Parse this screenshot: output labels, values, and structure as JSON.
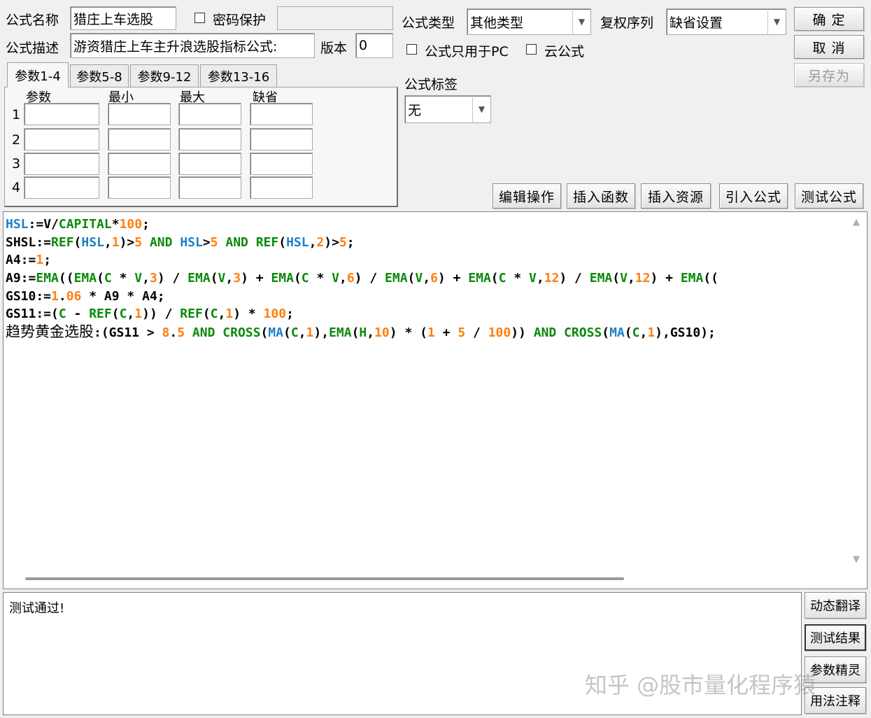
{
  "top": {
    "name_label": "公式名称",
    "name_value": "猎庄上车选股",
    "password_label": "密码保护",
    "type_label": "公式类型",
    "type_value": "其他类型",
    "rights_label": "复权序列",
    "rights_value": "缺省设置",
    "desc_label": "公式描述",
    "desc_value": "游资猎庄上车主升浪选股指标公式:",
    "version_label": "版本",
    "version_value": "0",
    "pc_only_label": "公式只用于PC",
    "cloud_label": "云公式",
    "tag_label": "公式标签",
    "tag_value": "无"
  },
  "buttons": {
    "ok": "确 定",
    "cancel": "取 消",
    "save_as": "另存为",
    "edit": "编辑操作",
    "insert_func": "插入函数",
    "insert_res": "插入资源",
    "import": "引入公式",
    "test": "测试公式",
    "dyn_translate": "动态翻译",
    "test_result": "测试结果",
    "param_wizard": "参数精灵",
    "usage_notes": "用法注释"
  },
  "tabs": [
    "参数1-4",
    "参数5-8",
    "参数9-12",
    "参数13-16"
  ],
  "params": {
    "headers": [
      "参数",
      "最小",
      "最大",
      "缺省"
    ],
    "rows": [
      "1",
      "2",
      "3",
      "4"
    ]
  },
  "colors": {
    "blue": "#1f7fc7",
    "green": "#0a8a0a",
    "orange": "#ff7f0e",
    "black": "#000000"
  },
  "code_lines": [
    [
      [
        "HSL",
        "blue"
      ],
      [
        ":=V/",
        "black"
      ],
      [
        "CAPITAL",
        "green"
      ],
      [
        "*",
        "black"
      ],
      [
        "100",
        "orange"
      ],
      [
        ";",
        "black"
      ]
    ],
    [
      [
        "SHSL:=",
        "black"
      ],
      [
        "REF",
        "green"
      ],
      [
        "(",
        "black"
      ],
      [
        "HSL",
        "blue"
      ],
      [
        ",",
        "black"
      ],
      [
        "1",
        "orange"
      ],
      [
        ")>",
        "black"
      ],
      [
        "5",
        "orange"
      ],
      [
        " AND ",
        "green"
      ],
      [
        "HSL",
        "blue"
      ],
      [
        ">",
        "black"
      ],
      [
        "5",
        "orange"
      ],
      [
        " AND ",
        "green"
      ],
      [
        "REF",
        "green"
      ],
      [
        "(",
        "black"
      ],
      [
        "HSL",
        "blue"
      ],
      [
        ",",
        "black"
      ],
      [
        "2",
        "orange"
      ],
      [
        ")>",
        "black"
      ],
      [
        "5",
        "orange"
      ],
      [
        ";",
        "black"
      ]
    ],
    [
      [
        "A4:=",
        "black"
      ],
      [
        "1",
        "orange"
      ],
      [
        ";",
        "black"
      ]
    ],
    [
      [
        "A9:=",
        "black"
      ],
      [
        "EMA",
        "green"
      ],
      [
        "((",
        "black"
      ],
      [
        "EMA",
        "green"
      ],
      [
        "(",
        "black"
      ],
      [
        "C",
        "green"
      ],
      [
        " * ",
        "black"
      ],
      [
        "V",
        "green"
      ],
      [
        ",",
        "black"
      ],
      [
        "3",
        "orange"
      ],
      [
        ") / ",
        "black"
      ],
      [
        "EMA",
        "green"
      ],
      [
        "(",
        "black"
      ],
      [
        "V",
        "green"
      ],
      [
        ",",
        "black"
      ],
      [
        "3",
        "orange"
      ],
      [
        ") + ",
        "black"
      ],
      [
        "EMA",
        "green"
      ],
      [
        "(",
        "black"
      ],
      [
        "C",
        "green"
      ],
      [
        " * ",
        "black"
      ],
      [
        "V",
        "green"
      ],
      [
        ",",
        "black"
      ],
      [
        "6",
        "orange"
      ],
      [
        ") / ",
        "black"
      ],
      [
        "EMA",
        "green"
      ],
      [
        "(",
        "black"
      ],
      [
        "V",
        "green"
      ],
      [
        ",",
        "black"
      ],
      [
        "6",
        "orange"
      ],
      [
        ") + ",
        "black"
      ],
      [
        "EMA",
        "green"
      ],
      [
        "(",
        "black"
      ],
      [
        "C",
        "green"
      ],
      [
        " * ",
        "black"
      ],
      [
        "V",
        "green"
      ],
      [
        ",",
        "black"
      ],
      [
        "12",
        "orange"
      ],
      [
        ") / ",
        "black"
      ],
      [
        "EMA",
        "green"
      ],
      [
        "(",
        "black"
      ],
      [
        "V",
        "green"
      ],
      [
        ",",
        "black"
      ],
      [
        "12",
        "orange"
      ],
      [
        ") + ",
        "black"
      ],
      [
        "EMA",
        "green"
      ],
      [
        "((",
        "black"
      ]
    ],
    [
      [
        "GS10:=",
        "black"
      ],
      [
        "1",
        "orange"
      ],
      [
        ".",
        "black"
      ],
      [
        "06",
        "orange"
      ],
      [
        " * A9 * A4;",
        "black"
      ]
    ],
    [
      [
        "GS11:=(",
        "black"
      ],
      [
        "C",
        "green"
      ],
      [
        " - ",
        "black"
      ],
      [
        "REF",
        "green"
      ],
      [
        "(",
        "black"
      ],
      [
        "C",
        "green"
      ],
      [
        ",",
        "black"
      ],
      [
        "1",
        "orange"
      ],
      [
        ")) / ",
        "black"
      ],
      [
        "REF",
        "green"
      ],
      [
        "(",
        "black"
      ],
      [
        "C",
        "green"
      ],
      [
        ",",
        "black"
      ],
      [
        "1",
        "orange"
      ],
      [
        ") * ",
        "black"
      ],
      [
        "100",
        "orange"
      ],
      [
        ";",
        "black"
      ]
    ],
    [
      [
        "趋势黄金选股",
        "cn"
      ],
      [
        ":(GS11 > ",
        "black"
      ],
      [
        "8",
        "orange"
      ],
      [
        ".",
        "black"
      ],
      [
        "5",
        "orange"
      ],
      [
        " AND ",
        "green"
      ],
      [
        "CROSS",
        "green"
      ],
      [
        "(",
        "black"
      ],
      [
        "MA",
        "blue"
      ],
      [
        "(",
        "black"
      ],
      [
        "C",
        "green"
      ],
      [
        ",",
        "black"
      ],
      [
        "1",
        "orange"
      ],
      [
        "),",
        "black"
      ],
      [
        "EMA",
        "green"
      ],
      [
        "(",
        "black"
      ],
      [
        "H",
        "green"
      ],
      [
        ",",
        "black"
      ],
      [
        "10",
        "orange"
      ],
      [
        ") * (",
        "black"
      ],
      [
        "1",
        "orange"
      ],
      [
        " + ",
        "black"
      ],
      [
        "5",
        "orange"
      ],
      [
        " / ",
        "black"
      ],
      [
        "100",
        "orange"
      ],
      [
        ")) ",
        "black"
      ],
      [
        "AND ",
        "green"
      ],
      [
        "CROSS",
        "green"
      ],
      [
        "(",
        "black"
      ],
      [
        "MA",
        "blue"
      ],
      [
        "(",
        "black"
      ],
      [
        "C",
        "green"
      ],
      [
        ",",
        "black"
      ],
      [
        "1",
        "orange"
      ],
      [
        "),GS10);",
        "black"
      ]
    ]
  ],
  "output": {
    "message": "测试通过!"
  },
  "watermark": "知乎 @股市量化程序猿"
}
